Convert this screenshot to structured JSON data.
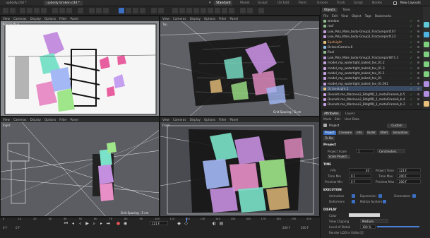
{
  "doc_tabs": [
    "upbody.c4d *",
    "upbody broken.c4d *"
  ],
  "layout_tabs": [
    "Standard",
    "Model",
    "Sculpt",
    "UV Edit",
    "Paint",
    "Groom",
    "Track",
    "Script",
    "Nodes"
  ],
  "new_layouts": "New Layouts",
  "viewports": [
    {
      "menu": [
        "View",
        "Cameras",
        "Display",
        "Options",
        "Filter",
        "Panel"
      ],
      "camera": "Perspective",
      "grid": ""
    },
    {
      "menu": [
        "View",
        "Cameras",
        "Display",
        "Options",
        "Filter",
        "Panel"
      ],
      "camera": "Top",
      "grid": "Grid Spacing : 5 cm"
    },
    {
      "menu": [
        "View",
        "Cameras",
        "Display",
        "Options",
        "Filter",
        "Panel"
      ],
      "camera": "Right",
      "grid": "Grid Spacing : 5 cm"
    },
    {
      "menu": [
        "View",
        "Cameras",
        "Display",
        "Options",
        "Filter",
        "Panel"
      ],
      "camera": "Front",
      "grid": "Grid Spacing : 5 cm"
    }
  ],
  "objects": {
    "tabs": [
      "Objects",
      "Takes"
    ],
    "menu": [
      "File",
      "Edit",
      "View",
      "Object",
      "Tags",
      "Bookmarks"
    ],
    "rows": [
      {
        "name": "window",
        "color": "#8fbf8f",
        "sel": false,
        "hl": false
      },
      {
        "name": "roof",
        "color": "#8fbf8f",
        "sel": false,
        "hl": false
      },
      {
        "name": "Low_Poly_Male_body-Group2_Fracturepart107",
        "color": "#c7a0e0",
        "sel": false,
        "hl": false
      },
      {
        "name": "Low_Poly_Male_body-Group2_Fracturepart123",
        "color": "#c7a0e0",
        "sel": false,
        "hl": false
      },
      {
        "name": "SpotLight",
        "color": "#e8c07a",
        "sel": false,
        "hl": true
      },
      {
        "name": "OctaneCamera.6",
        "color": "#8ec0e8",
        "sel": false,
        "hl": false
      },
      {
        "name": "final",
        "color": "#8fbf8f",
        "sel": false,
        "hl": false
      },
      {
        "name": "Low_Poly_Male_body-Group2_Fracturepart871.1",
        "color": "#c7a0e0",
        "sel": false,
        "hl": false
      },
      {
        "name": "model_mp_watertight_baked_tex_01.2",
        "color": "#c7a0e0",
        "sel": false,
        "hl": false
      },
      {
        "name": "model_mp_watertight_baked_tex_01.3",
        "color": "#c7a0e0",
        "sel": false,
        "hl": false
      },
      {
        "name": "model_mp_watertight_baked_tex_01.1",
        "color": "#c7a0e0",
        "sel": false,
        "hl": false
      },
      {
        "name": "model_mp_watertight_baked_tex_01",
        "color": "#c7a0e0",
        "sel": false,
        "hl": false
      },
      {
        "name": "model_mp_watertight_baked_tex_01.001",
        "color": "#c7a0e0",
        "sel": false,
        "hl": false
      },
      {
        "name": "OctaneLight.2",
        "color": "#e8c07a",
        "sel": true,
        "hl": false
      },
      {
        "name": "Desnefs.me_Warzone2_BldgMD_1_metalFrameA_b.5",
        "color": "#c7a0e0",
        "sel": false,
        "hl": false
      },
      {
        "name": "Desnefs.me_Warzone2_BldgMD_1_metalFrameA_b.4",
        "color": "#c7a0e0",
        "sel": false,
        "hl": false
      },
      {
        "name": "Desnefs.me_Warzone2_BldgMD_1_metalFrameA_b.3",
        "color": "#c7a0e0",
        "sel": false,
        "hl": false
      }
    ]
  },
  "attributes": {
    "tabs": [
      "Attributes",
      "Layers"
    ],
    "menu": [
      "Mode",
      "Edit",
      "User Data"
    ],
    "object_label": "Project",
    "preset": "Custom",
    "subtabs": [
      "Project",
      "Cineware",
      "Info",
      "Bullet",
      "XRefs",
      "Simulation"
    ],
    "subtab2": "To Do",
    "section_title": "Project",
    "project_scale_label": "Project Scale",
    "project_scale_value": "1",
    "project_scale_unit": "Centimeters",
    "scale_button": "Scale Project...",
    "time_title": "TIME",
    "fps_label": "FPS",
    "fps_value": "30",
    "project_time_label": "Project Time",
    "project_time_value": "121 F",
    "min_time_label": "Time Min",
    "min_time_value": "0 F",
    "max_time_label": "Time Max",
    "max_time_value": "200 F",
    "preview_min_label": "Preview Min",
    "preview_min_value": "0 F",
    "preview_max_label": "Preview Max",
    "preview_max_value": "200 F",
    "execution_title": "EXECUTION",
    "exec_items": [
      "Animation",
      "Expression",
      "Generators",
      "Deformers",
      "Motion System"
    ],
    "display_title": "DISPLAY",
    "color_label": "Color",
    "clipping_label": "View Clipping",
    "clipping_value": "Medium",
    "lod_label": "Level of Detail",
    "lod_value": "100 %",
    "lod_fraction": 1.0,
    "render_lod_label": "Render LOD in Editor"
  },
  "timeline": {
    "ticks": [
      "0",
      "10",
      "20",
      "30",
      "40",
      "50",
      "60",
      "70",
      "80",
      "90",
      "100",
      "110",
      "120",
      "130",
      "140",
      "150",
      "160",
      "170",
      "180",
      "190",
      "200"
    ],
    "start": "0 F",
    "current": "121 F",
    "end": "200 F",
    "end2": "200 F",
    "current_fraction": 0.605
  }
}
